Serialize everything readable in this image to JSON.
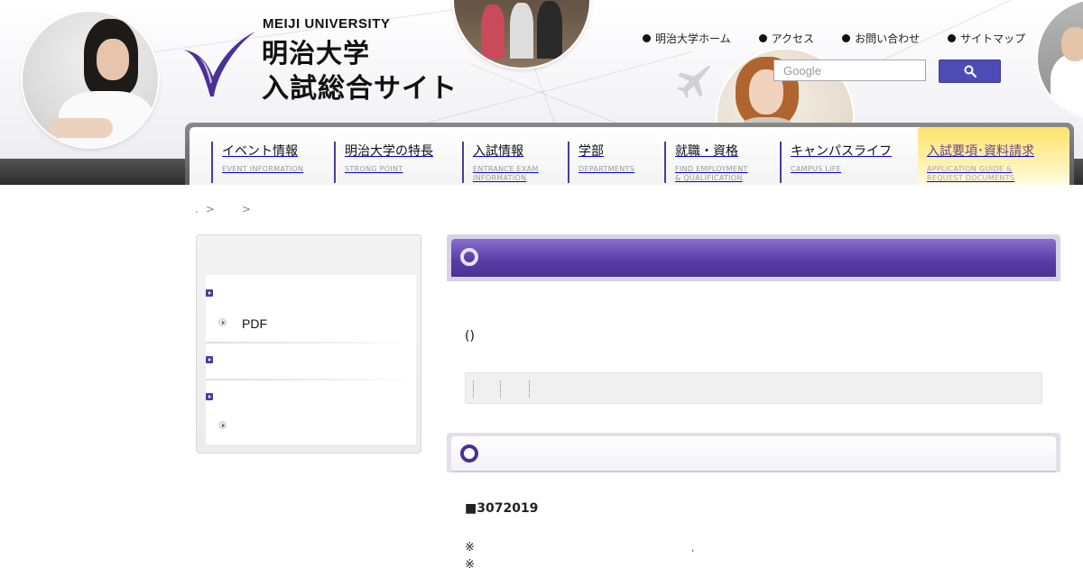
{
  "header": {
    "logo": {
      "en": "MEIJI UNIVERSITY",
      "jp_line1": "明治大学",
      "jp_line2": "入試総合サイト"
    },
    "util_nav": [
      "明治大学ホーム",
      "アクセス",
      "お問い合わせ",
      "サイトマップ"
    ],
    "search": {
      "placeholder": "Google",
      "button_icon": "search-icon"
    }
  },
  "global_nav": [
    {
      "jp": "イベント情報",
      "en": "EVENT INFORMATION"
    },
    {
      "jp": "明治大学の特長",
      "en": "STRONG POINT"
    },
    {
      "jp": "入試情報",
      "en": "ENTRANCE EXAM\nINFORMATION"
    },
    {
      "jp": "学部",
      "en": "DEPARTMENTS"
    },
    {
      "jp": "就職・資格",
      "en": "FIND EMPLOYMENT\n& QUALIFICATION"
    },
    {
      "jp": "キャンパスライフ",
      "en": "CAMPUS LIFE"
    },
    {
      "jp": "入試要項･資料請求",
      "en": "APPLICATION GUIDE &\nREQUEST DOCUMENTS"
    }
  ],
  "breadcrumb": {
    "lead": ".",
    "sep1": ">",
    "sep2": ">"
  },
  "sidebar": {
    "pdf_label": "PDF"
  },
  "main": {
    "paren_text": "()",
    "notice_title": "■3072019",
    "note_mark": "※",
    "note_comma": ","
  },
  "colors": {
    "brand_purple": "#4b3195",
    "accent_yellow": "#ffe36a",
    "search_blue": "#4d4cb4"
  }
}
